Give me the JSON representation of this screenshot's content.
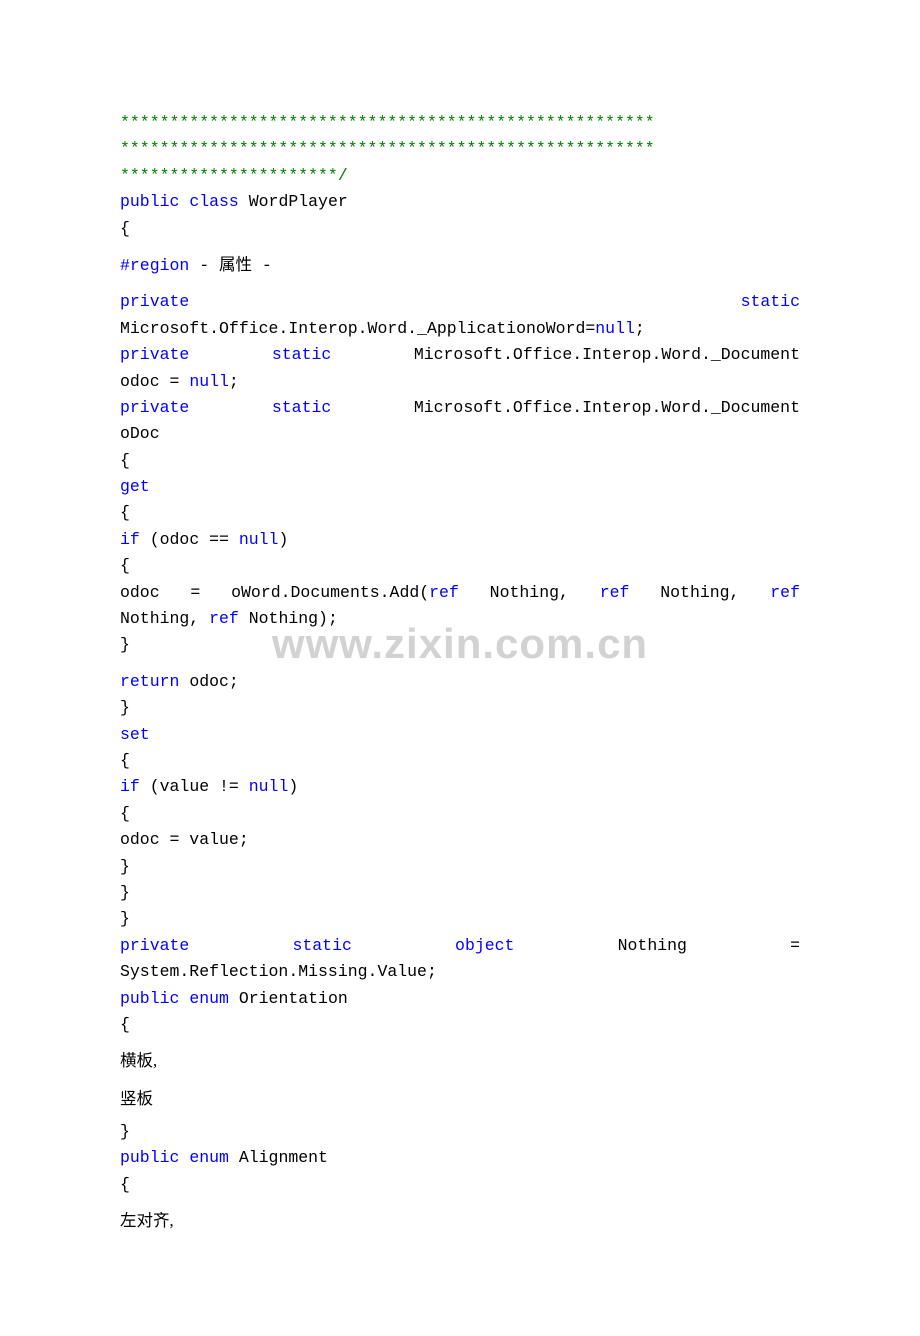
{
  "watermark": "www.zixin.com.cn",
  "lines": {
    "l01": "******************************************************",
    "l02": "******************************************************",
    "l03": "**********************/",
    "l04a": "public",
    "l04b": " ",
    "l04c": "class",
    "l04d": " WordPlayer",
    "l05": "{",
    "l06a": "#region",
    "l06b": " - ",
    "l06c": "属性",
    "l06d": " -",
    "l07a": "private",
    "l07b": "static",
    "l08a": "Microsoft.Office.Interop.Word._ApplicationoWord=",
    "l08b": "null",
    "l08c": ";",
    "l09a": "private",
    "l09b": " ",
    "l09c": "static",
    "l09d": " Microsoft.Office.Interop.Word._Document ",
    "l10a": "odoc = ",
    "l10b": "null",
    "l10c": ";",
    "l11a": "private",
    "l11b": " ",
    "l11c": "static",
    "l11d": " Microsoft.Office.Interop.Word._Document ",
    "l12": "oDoc",
    "l13": "{",
    "l14": "get",
    "l15": "{",
    "l16a": "if",
    "l16b": " (odoc == ",
    "l16c": "null",
    "l16d": ")",
    "l17": "{",
    "l18a": "odoc = oWord.Documents.Add(",
    "l18b": "ref",
    "l18c": " Nothing, ",
    "l18d": "ref",
    "l18e": " Nothing, ",
    "l18f": "ref",
    "l18g": " ",
    "l19a": "Nothing, ",
    "l19b": "ref",
    "l19c": " Nothing);",
    "l20": "}",
    "l21a": "return",
    "l21b": " odoc;",
    "l22": "}",
    "l23": "set",
    "l24": "{",
    "l25a": "if",
    "l25b": " (value != ",
    "l25c": "null",
    "l25d": ")",
    "l26": "{",
    "l27": "odoc = value;",
    "l28": "}",
    "l29": "}",
    "l30": "}",
    "l31a": "private",
    "l31b": "static",
    "l31c": "object",
    "l31d": "Nothing",
    "l31e": "=",
    "l32": "System.Reflection.Missing.Value;",
    "l33a": "public",
    "l33b": " ",
    "l33c": "enum",
    "l33d": " Orientation",
    "l34": "{",
    "l35": "横板,",
    "l36": "竖板",
    "l37": "}",
    "l38a": "public",
    "l38b": " ",
    "l38c": "enum",
    "l38d": " Alignment",
    "l39": "{",
    "l40": "左对齐,"
  }
}
